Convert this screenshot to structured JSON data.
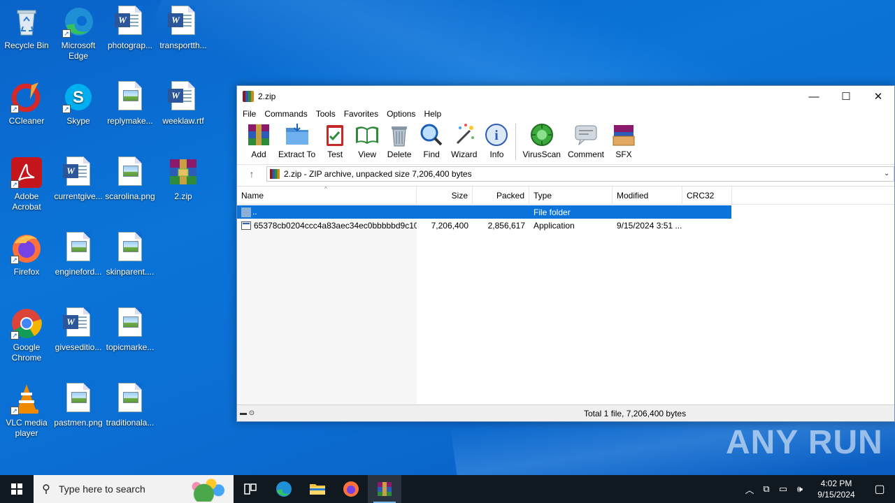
{
  "desktop": {
    "icons": [
      {
        "label": "Recycle Bin",
        "icon": "recycle-bin-icon"
      },
      {
        "label": "Microsoft Edge",
        "icon": "edge-icon"
      },
      {
        "label": "photograp...",
        "icon": "word-doc-icon"
      },
      {
        "label": "transportth...",
        "icon": "word-doc-icon"
      },
      {
        "label": "CCleaner",
        "icon": "ccleaner-icon"
      },
      {
        "label": "Skype",
        "icon": "skype-icon"
      },
      {
        "label": "replymake...",
        "icon": "image-file-icon"
      },
      {
        "label": "weeklaw.rtf",
        "icon": "word-doc-icon"
      },
      {
        "label": "Adobe Acrobat",
        "icon": "acrobat-icon"
      },
      {
        "label": "currentgive...",
        "icon": "word-doc-icon"
      },
      {
        "label": "scarolina.png",
        "icon": "image-file-icon"
      },
      {
        "label": "2.zip",
        "icon": "winrar-archive-icon"
      },
      {
        "label": "Firefox",
        "icon": "firefox-icon"
      },
      {
        "label": "engineford...",
        "icon": "image-file-icon"
      },
      {
        "label": "skinparent....",
        "icon": "image-file-icon"
      },
      {
        "label": "Google Chrome",
        "icon": "chrome-icon"
      },
      {
        "label": "giveseditio...",
        "icon": "word-doc-icon"
      },
      {
        "label": "topicmarke...",
        "icon": "image-file-icon"
      },
      {
        "label": "VLC media player",
        "icon": "vlc-icon"
      },
      {
        "label": "pastmen.png",
        "icon": "image-file-icon"
      },
      {
        "label": "traditionala...",
        "icon": "image-file-icon"
      }
    ]
  },
  "window": {
    "title": "2.zip",
    "menu": [
      "File",
      "Commands",
      "Tools",
      "Favorites",
      "Options",
      "Help"
    ],
    "toolbar": [
      "Add",
      "Extract To",
      "Test",
      "View",
      "Delete",
      "Find",
      "Wizard",
      "Info",
      "VirusScan",
      "Comment",
      "SFX"
    ],
    "address": "2.zip - ZIP archive, unpacked size 7,206,400 bytes",
    "columns": [
      "Name",
      "Size",
      "Packed",
      "Type",
      "Modified",
      "CRC32"
    ],
    "rows": [
      {
        "name": "..",
        "size": "",
        "packed": "",
        "type": "File folder",
        "modified": "",
        "crc": ""
      },
      {
        "name": "65378cb0204ccc4a83aec34ec0bbbbbd9c10...",
        "size": "7,206,400",
        "packed": "2,856,617",
        "type": "Application",
        "modified": "9/15/2024 3:51 ...",
        "crc": ""
      }
    ],
    "status": "Total 1 file, 7,206,400 bytes"
  },
  "watermark": "ANY RUN",
  "taskbar": {
    "search_placeholder": "Type here to search",
    "time": "4:02 PM",
    "date": "9/15/2024"
  },
  "colors": {
    "selection": "#0a74da",
    "desktop": "#0a6cd0",
    "taskbar": "#101820"
  }
}
